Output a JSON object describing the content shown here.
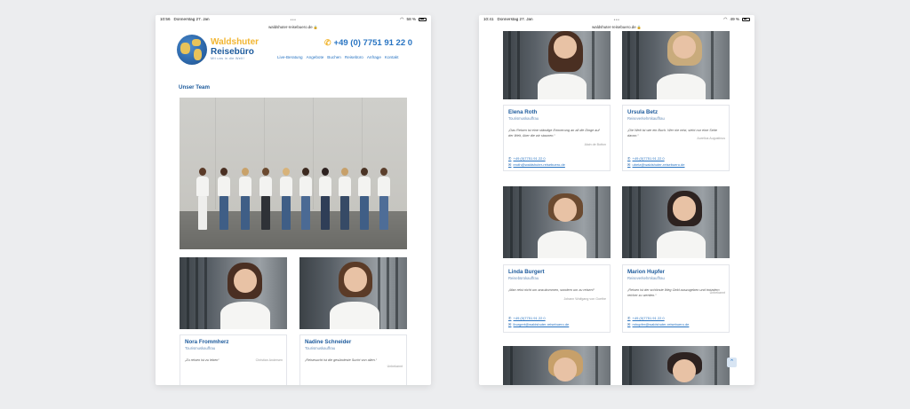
{
  "left_tablet": {
    "status": {
      "time": "10:56",
      "date": "Donnerstag 27. Jan",
      "battery": "58 %",
      "battery_level": 0.58
    },
    "url": "waldshuter-reisebuero.de",
    "brand": {
      "line1": "Waldshuter",
      "line2": "Reisebüro",
      "tagline": "Mit uns in die Welt!"
    },
    "phone": "+49 (0) 7751 91 22 0",
    "nav": [
      "Live-Beratung",
      "Angebote",
      "Buchen",
      "Reisebüro",
      "Anfrage",
      "Kontakt"
    ],
    "section_title": "Unser Team",
    "members": [
      {
        "name": "Nora Frommherz",
        "role": "Tourismuskauffrau",
        "quote": "„Zu reisen ist zu leben“",
        "author": "Christian Andersen"
      },
      {
        "name": "Nadine Schneider",
        "role": "Tourismuskauffrau",
        "quote": "„Reisesucht ist die gesündeste Sucht von allen.“",
        "author": "Unbekannt"
      }
    ]
  },
  "right_tablet": {
    "status": {
      "time": "10:41",
      "date": "Donnerstag 27. Jan",
      "battery": "49 %",
      "battery_level": 0.49
    },
    "url": "waldshuter-reisebuero.de",
    "members": [
      {
        "name": "Elena Roth",
        "role": "Tourismuskauffrau",
        "quote": "„Das Reisen ist eine ständige Erinnerung an all die Dinge auf der Welt, über die wir staunen.“",
        "author": "Alain de Botton",
        "phone": "+49 (0)7751 91 22 0",
        "email": "eroth@waldshuter-reisebuero.de"
      },
      {
        "name": "Ursula Betz",
        "role": "Reiseverkehrskauffrau",
        "quote": "„Die Welt ist wie ein Buch. Wer nie reist, sieht nur eine Seite davon.“",
        "author": "Aurelius Augustinus",
        "phone": "+49 (0)7751 91 22 0",
        "email": "ubetz@waldshuter-reisebuero.de"
      },
      {
        "name": "Linda Burgert",
        "role": "Reisebürokauffrau",
        "quote": "„Man reist nicht um anzukommen, sondern um zu reisen!“",
        "author": "Johann Wolfgang von Goethe",
        "phone": "+49 (0)7751 91 22 0",
        "email": "lburgert@waldshuter-reisebuero.de"
      },
      {
        "name": "Marion Hupfer",
        "role": "Reiseverkehrskauffrau",
        "quote": "„Reisen ist der schönste Weg Geld auszugeben und trotzdem reicher zu werden.“",
        "author": "Unbekannt",
        "phone": "+49 (0)7751 91 22 0",
        "email": "mhupfer@waldshuter-reisebuero.de"
      }
    ]
  },
  "colors": {
    "brand_blue": "#1c5a9c",
    "link_blue": "#2874c2",
    "brand_yellow": "#f2b632",
    "background": "#ecedef"
  },
  "icons": {
    "phone": "phone-icon",
    "email": "email-icon",
    "scroll_top": "chevron-up-icon",
    "wifi": "wifi-icon",
    "lock": "lock-icon"
  }
}
